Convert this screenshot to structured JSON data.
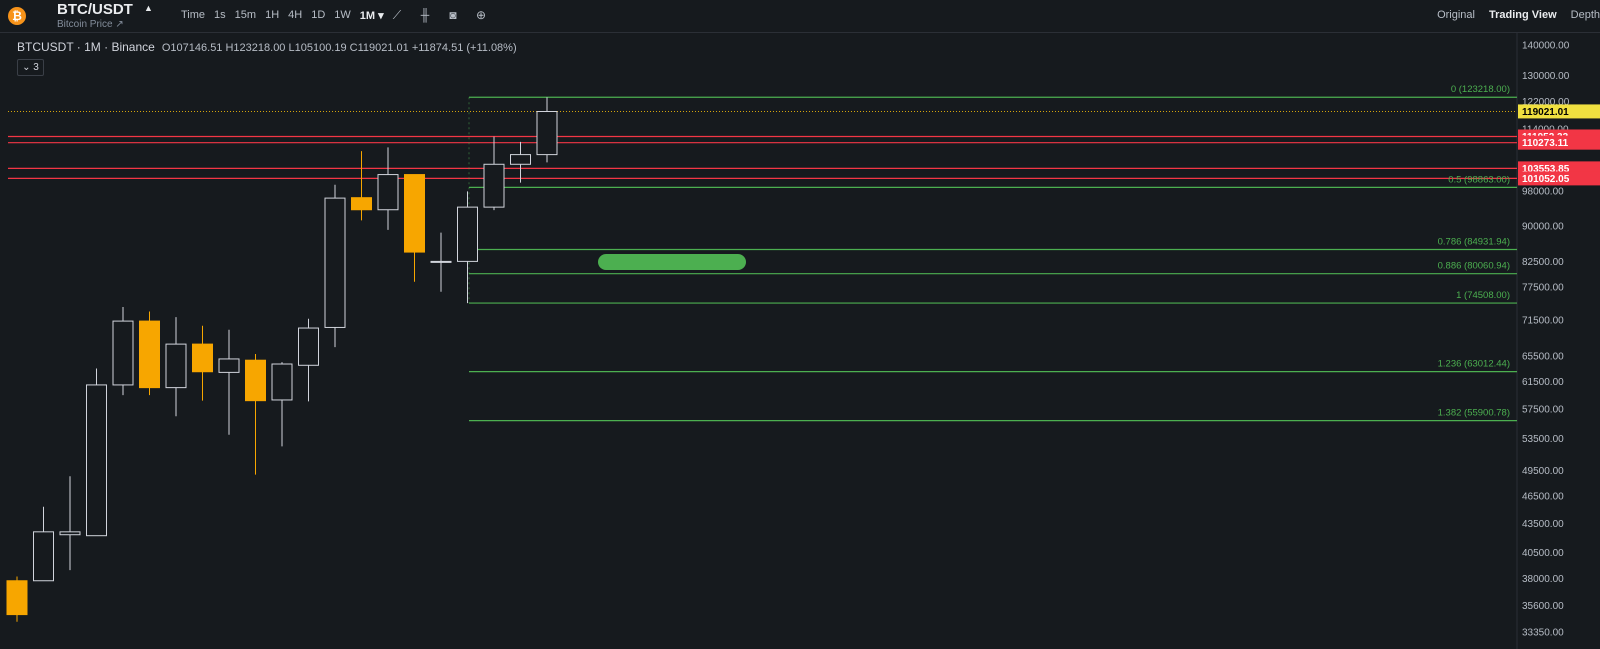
{
  "header": {
    "logo_glyph": "₿",
    "pair": "BTC/USDT",
    "subtitle": "Bitcoin Price ↗",
    "intervals": [
      "Time",
      "1s",
      "15m",
      "1H",
      "4H",
      "1D",
      "1W",
      "1M ▾"
    ],
    "active_interval": "1M ▾",
    "toolbar_icons": [
      "indicator-icon",
      "candle-type-icon",
      "camera-icon",
      "add-icon"
    ],
    "views": [
      "Original",
      "Trading View",
      "Depth"
    ],
    "active_view": "Trading View"
  },
  "legend": {
    "symbol_text": "BTCUSDT · 1M · Binance",
    "ohlc_text": "O107146.51  H123218.00  L105100.19  C119021.01  +11874.51 (+11.08%)",
    "collapse_label": "⌄ 3"
  },
  "chart_data": {
    "type": "candlestick",
    "price_axis_ticks": [
      "140000.00",
      "130000.00",
      "122000.00",
      "114000.00",
      "98000.00",
      "90000.00",
      "82500.00",
      "77500.00",
      "71500.00",
      "65500.00",
      "61500.00",
      "57500.00",
      "53500.00",
      "49500.00",
      "46500.00",
      "43500.00",
      "40500.00",
      "38000.00",
      "35600.00",
      "33350.00"
    ],
    "candles": [
      {
        "o": 37800,
        "h": 38200,
        "l": 34200,
        "c": 34800
      },
      {
        "o": 37800,
        "h": 45300,
        "l": 37800,
        "c": 42600
      },
      {
        "o": 42300,
        "h": 48800,
        "l": 38800,
        "c": 42600
      },
      {
        "o": 42200,
        "h": 63500,
        "l": 42200,
        "c": 61000
      },
      {
        "o": 61000,
        "h": 73800,
        "l": 59500,
        "c": 71300
      },
      {
        "o": 71300,
        "h": 73000,
        "l": 59500,
        "c": 60600
      },
      {
        "o": 60600,
        "h": 72000,
        "l": 56500,
        "c": 67400
      },
      {
        "o": 67400,
        "h": 70500,
        "l": 58700,
        "c": 63000
      },
      {
        "o": 62900,
        "h": 69800,
        "l": 54000,
        "c": 65000
      },
      {
        "o": 64800,
        "h": 65800,
        "l": 49000,
        "c": 58700
      },
      {
        "o": 58800,
        "h": 64500,
        "l": 52500,
        "c": 64200
      },
      {
        "o": 64000,
        "h": 71700,
        "l": 58600,
        "c": 70100
      },
      {
        "o": 70200,
        "h": 99500,
        "l": 66900,
        "c": 96300
      },
      {
        "o": 96400,
        "h": 108000,
        "l": 91200,
        "c": 93600
      },
      {
        "o": 93600,
        "h": 109000,
        "l": 89100,
        "c": 102000
      },
      {
        "o": 102000,
        "h": 102000,
        "l": 78500,
        "c": 84400
      },
      {
        "o": 82500,
        "h": 88500,
        "l": 76600,
        "c": 82500
      },
      {
        "o": 82500,
        "h": 97900,
        "l": 74500,
        "c": 94200
      },
      {
        "o": 94200,
        "h": 111900,
        "l": 93500,
        "c": 104600
      },
      {
        "o": 104600,
        "h": 110500,
        "l": 100000,
        "c": 107100
      },
      {
        "o": 107100,
        "h": 123200,
        "l": 105100,
        "c": 119000
      }
    ],
    "fib_levels": [
      {
        "label": "0 (123218.00)",
        "price": 123218.0
      },
      {
        "label": "0.5 (98863.00)",
        "price": 98863.0
      },
      {
        "label": "0.786 (84931.94)",
        "price": 84931.94
      },
      {
        "label": "0.886 (80060.94)",
        "price": 80060.94
      },
      {
        "label": "1 (74508.00)",
        "price": 74508.0
      },
      {
        "label": "1.236 (63012.44)",
        "price": 63012.44
      },
      {
        "label": "1.382 (55900.78)",
        "price": 55900.78
      }
    ],
    "horizontal_lines": [
      111952.33,
      110273.11,
      103553.85,
      101052.05
    ],
    "price_tags": [
      {
        "text": "119021.01",
        "price": 119021.01,
        "bg": "#f0e040",
        "fg": "#000000"
      },
      {
        "text": "111952.33",
        "price": 111952.33,
        "bg": "#f23645",
        "fg": "#ffffff"
      },
      {
        "text": "110273.11",
        "price": 110273.11,
        "bg": "#f23645",
        "fg": "#ffffff"
      },
      {
        "text": "103553.85",
        "price": 103553.85,
        "bg": "#f23645",
        "fg": "#ffffff"
      },
      {
        "text": "101052.05",
        "price": 101052.05,
        "bg": "#f23645",
        "fg": "#ffffff"
      }
    ],
    "colors": {
      "up": "#161a1e",
      "up_border": "#d1d4dc",
      "down": "#f7a600",
      "fib": "#4caf50",
      "hline": "#f23645",
      "last": "#f0b90b"
    }
  }
}
